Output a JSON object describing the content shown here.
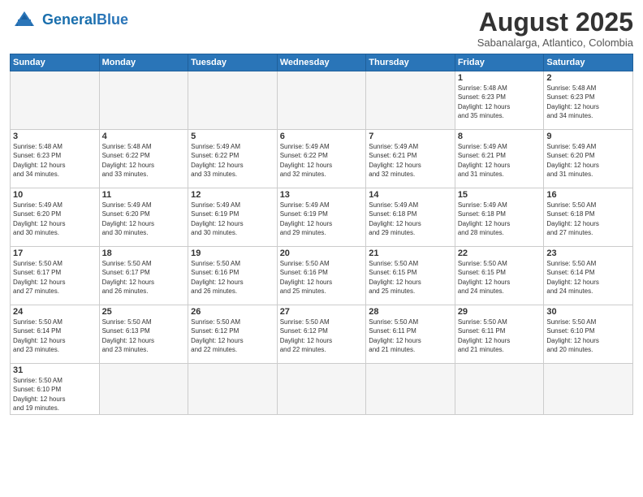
{
  "logo": {
    "general": "General",
    "blue": "Blue"
  },
  "header": {
    "month_year": "August 2025",
    "location": "Sabanalarga, Atlantico, Colombia"
  },
  "weekdays": [
    "Sunday",
    "Monday",
    "Tuesday",
    "Wednesday",
    "Thursday",
    "Friday",
    "Saturday"
  ],
  "weeks": [
    [
      {
        "day": "",
        "info": ""
      },
      {
        "day": "",
        "info": ""
      },
      {
        "day": "",
        "info": ""
      },
      {
        "day": "",
        "info": ""
      },
      {
        "day": "",
        "info": ""
      },
      {
        "day": "1",
        "info": "Sunrise: 5:48 AM\nSunset: 6:23 PM\nDaylight: 12 hours\nand 35 minutes."
      },
      {
        "day": "2",
        "info": "Sunrise: 5:48 AM\nSunset: 6:23 PM\nDaylight: 12 hours\nand 34 minutes."
      }
    ],
    [
      {
        "day": "3",
        "info": "Sunrise: 5:48 AM\nSunset: 6:23 PM\nDaylight: 12 hours\nand 34 minutes."
      },
      {
        "day": "4",
        "info": "Sunrise: 5:48 AM\nSunset: 6:22 PM\nDaylight: 12 hours\nand 33 minutes."
      },
      {
        "day": "5",
        "info": "Sunrise: 5:49 AM\nSunset: 6:22 PM\nDaylight: 12 hours\nand 33 minutes."
      },
      {
        "day": "6",
        "info": "Sunrise: 5:49 AM\nSunset: 6:22 PM\nDaylight: 12 hours\nand 32 minutes."
      },
      {
        "day": "7",
        "info": "Sunrise: 5:49 AM\nSunset: 6:21 PM\nDaylight: 12 hours\nand 32 minutes."
      },
      {
        "day": "8",
        "info": "Sunrise: 5:49 AM\nSunset: 6:21 PM\nDaylight: 12 hours\nand 31 minutes."
      },
      {
        "day": "9",
        "info": "Sunrise: 5:49 AM\nSunset: 6:20 PM\nDaylight: 12 hours\nand 31 minutes."
      }
    ],
    [
      {
        "day": "10",
        "info": "Sunrise: 5:49 AM\nSunset: 6:20 PM\nDaylight: 12 hours\nand 30 minutes."
      },
      {
        "day": "11",
        "info": "Sunrise: 5:49 AM\nSunset: 6:20 PM\nDaylight: 12 hours\nand 30 minutes."
      },
      {
        "day": "12",
        "info": "Sunrise: 5:49 AM\nSunset: 6:19 PM\nDaylight: 12 hours\nand 30 minutes."
      },
      {
        "day": "13",
        "info": "Sunrise: 5:49 AM\nSunset: 6:19 PM\nDaylight: 12 hours\nand 29 minutes."
      },
      {
        "day": "14",
        "info": "Sunrise: 5:49 AM\nSunset: 6:18 PM\nDaylight: 12 hours\nand 29 minutes."
      },
      {
        "day": "15",
        "info": "Sunrise: 5:49 AM\nSunset: 6:18 PM\nDaylight: 12 hours\nand 28 minutes."
      },
      {
        "day": "16",
        "info": "Sunrise: 5:50 AM\nSunset: 6:18 PM\nDaylight: 12 hours\nand 27 minutes."
      }
    ],
    [
      {
        "day": "17",
        "info": "Sunrise: 5:50 AM\nSunset: 6:17 PM\nDaylight: 12 hours\nand 27 minutes."
      },
      {
        "day": "18",
        "info": "Sunrise: 5:50 AM\nSunset: 6:17 PM\nDaylight: 12 hours\nand 26 minutes."
      },
      {
        "day": "19",
        "info": "Sunrise: 5:50 AM\nSunset: 6:16 PM\nDaylight: 12 hours\nand 26 minutes."
      },
      {
        "day": "20",
        "info": "Sunrise: 5:50 AM\nSunset: 6:16 PM\nDaylight: 12 hours\nand 25 minutes."
      },
      {
        "day": "21",
        "info": "Sunrise: 5:50 AM\nSunset: 6:15 PM\nDaylight: 12 hours\nand 25 minutes."
      },
      {
        "day": "22",
        "info": "Sunrise: 5:50 AM\nSunset: 6:15 PM\nDaylight: 12 hours\nand 24 minutes."
      },
      {
        "day": "23",
        "info": "Sunrise: 5:50 AM\nSunset: 6:14 PM\nDaylight: 12 hours\nand 24 minutes."
      }
    ],
    [
      {
        "day": "24",
        "info": "Sunrise: 5:50 AM\nSunset: 6:14 PM\nDaylight: 12 hours\nand 23 minutes."
      },
      {
        "day": "25",
        "info": "Sunrise: 5:50 AM\nSunset: 6:13 PM\nDaylight: 12 hours\nand 23 minutes."
      },
      {
        "day": "26",
        "info": "Sunrise: 5:50 AM\nSunset: 6:12 PM\nDaylight: 12 hours\nand 22 minutes."
      },
      {
        "day": "27",
        "info": "Sunrise: 5:50 AM\nSunset: 6:12 PM\nDaylight: 12 hours\nand 22 minutes."
      },
      {
        "day": "28",
        "info": "Sunrise: 5:50 AM\nSunset: 6:11 PM\nDaylight: 12 hours\nand 21 minutes."
      },
      {
        "day": "29",
        "info": "Sunrise: 5:50 AM\nSunset: 6:11 PM\nDaylight: 12 hours\nand 21 minutes."
      },
      {
        "day": "30",
        "info": "Sunrise: 5:50 AM\nSunset: 6:10 PM\nDaylight: 12 hours\nand 20 minutes."
      }
    ],
    [
      {
        "day": "31",
        "info": "Sunrise: 5:50 AM\nSunset: 6:10 PM\nDaylight: 12 hours\nand 19 minutes."
      },
      {
        "day": "",
        "info": ""
      },
      {
        "day": "",
        "info": ""
      },
      {
        "day": "",
        "info": ""
      },
      {
        "day": "",
        "info": ""
      },
      {
        "day": "",
        "info": ""
      },
      {
        "day": "",
        "info": ""
      }
    ]
  ]
}
